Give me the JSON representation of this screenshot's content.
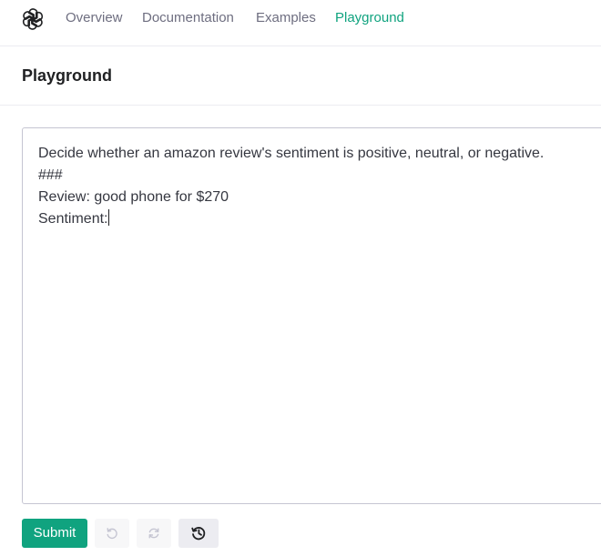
{
  "nav": {
    "items": [
      {
        "label": "Overview",
        "active": false
      },
      {
        "label": "Documentation",
        "active": false
      },
      {
        "label": "Examples",
        "active": false
      },
      {
        "label": "Playground",
        "active": true
      }
    ],
    "logo_icon": "openai-logo-icon"
  },
  "page": {
    "title": "Playground"
  },
  "editor": {
    "lines": [
      "Decide whether an amazon review's sentiment is positive, neutral, or negative.",
      "###",
      "Review: good phone for $270",
      "Sentiment:"
    ]
  },
  "actions": {
    "submit_label": "Submit",
    "undo_icon": "undo-icon",
    "redo_icon": "redo-icon",
    "history_icon": "history-icon"
  },
  "colors": {
    "accent": "#10a37f",
    "text": "#353740",
    "muted": "#6e6e80",
    "border": "#c5c5d2"
  }
}
